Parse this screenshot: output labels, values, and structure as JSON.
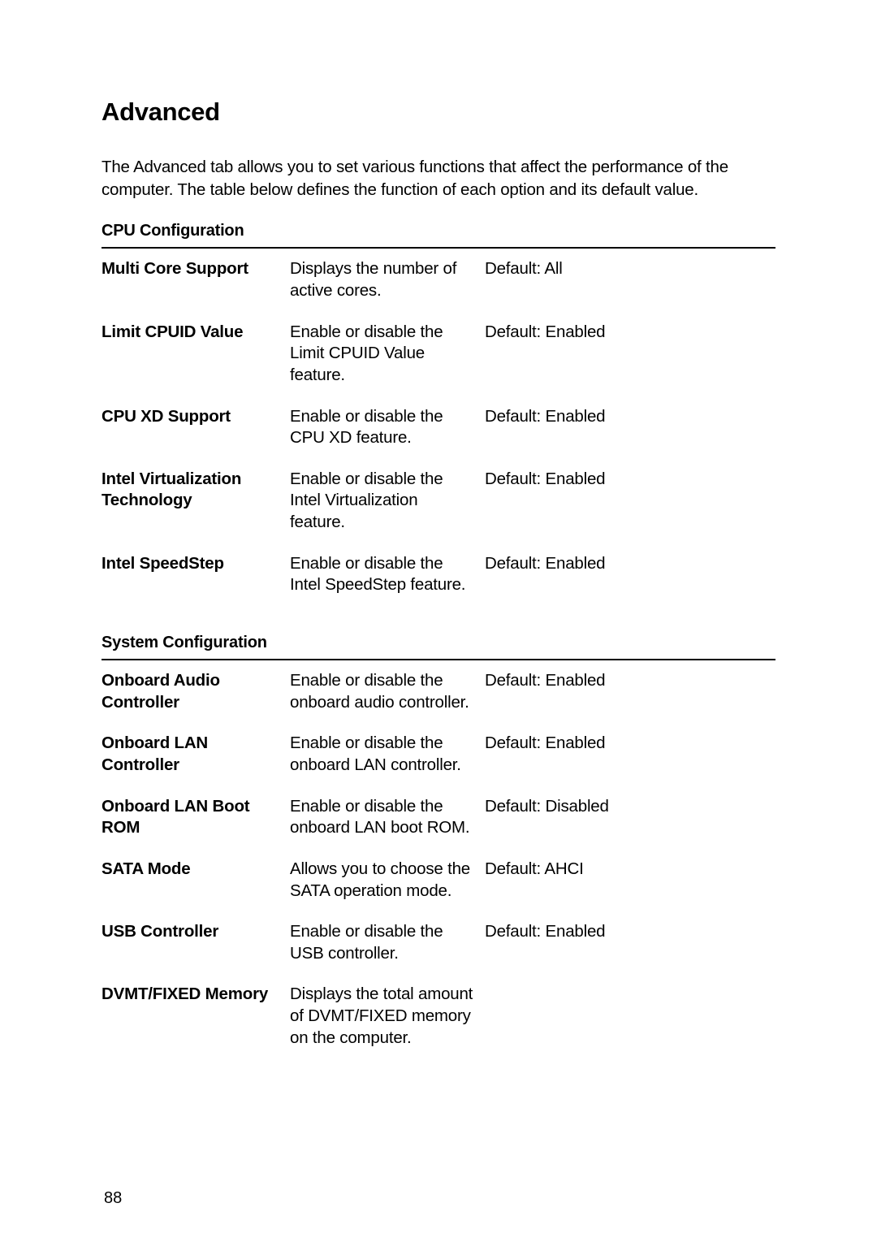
{
  "heading": "Advanced",
  "intro": "The Advanced tab allows you to set various functions that affect the performance of the computer. The table below defines the function of each option and its default value.",
  "sections": [
    {
      "title": "CPU Configuration",
      "rows": [
        {
          "name": "Multi Core Support",
          "desc": "Displays the number of active cores.",
          "default": "Default: All"
        },
        {
          "name": "Limit CPUID Value",
          "desc": "Enable or disable the Limit CPUID Value feature.",
          "default": "Default: Enabled"
        },
        {
          "name": "CPU XD Support",
          "desc": "Enable or disable the CPU XD feature.",
          "default": "Default: Enabled"
        },
        {
          "name": "Intel Virtualization Technology",
          "desc": "Enable or disable the Intel Virtualization feature.",
          "default": "Default: Enabled"
        },
        {
          "name": "Intel SpeedStep",
          "desc": "Enable or disable the Intel SpeedStep feature.",
          "default": "Default: Enabled"
        }
      ]
    },
    {
      "title": "System Configuration",
      "rows": [
        {
          "name": "Onboard Audio Controller",
          "desc": "Enable or disable the onboard audio controller.",
          "default": "Default: Enabled"
        },
        {
          "name": "Onboard LAN Controller",
          "desc": "Enable or disable the onboard LAN controller.",
          "default": "Default: Enabled"
        },
        {
          "name": "Onboard LAN Boot ROM",
          "desc": "Enable or disable the onboard LAN boot ROM.",
          "default": "Default: Disabled"
        },
        {
          "name": "SATA Mode",
          "desc": "Allows you to choose the SATA operation mode.",
          "default": "Default: AHCI"
        },
        {
          "name": "USB Controller",
          "desc": "Enable or disable the USB controller.",
          "default": "Default: Enabled"
        },
        {
          "name": "DVMT/FIXED Memory",
          "desc": "Displays the total amount of DVMT/FIXED memory on the computer.",
          "default": ""
        }
      ]
    }
  ],
  "page_number": "88"
}
